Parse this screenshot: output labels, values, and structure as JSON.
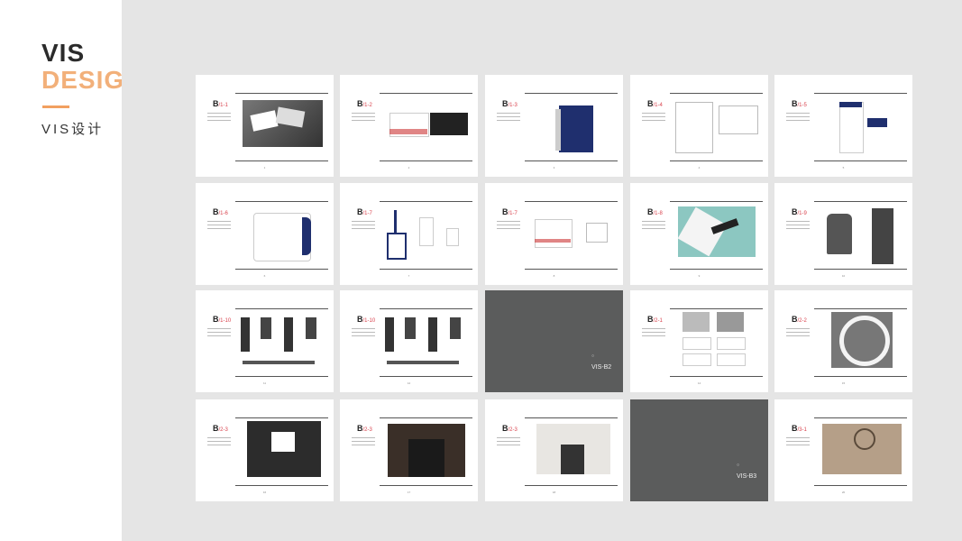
{
  "heading": {
    "line1": "VIS",
    "line2": "DESIGN",
    "subtitle": "VIS设计"
  },
  "pages": [
    {
      "num": "1",
      "code_main": "B",
      "code_sub": "/1-1",
      "kind": "cards"
    },
    {
      "num": "2",
      "code_main": "B",
      "code_sub": "/1-2",
      "kind": "bizcard"
    },
    {
      "num": "3",
      "code_main": "B",
      "code_sub": "/1-3",
      "kind": "folder"
    },
    {
      "num": "4",
      "code_main": "B",
      "code_sub": "/1-4",
      "kind": "letter"
    },
    {
      "num": "5",
      "code_main": "B",
      "code_sub": "/1-5",
      "kind": "envelope"
    },
    {
      "num": "6",
      "code_main": "B",
      "code_sub": "/1-6",
      "kind": "envelope2"
    },
    {
      "num": "7",
      "code_main": "B",
      "code_sub": "/1-7",
      "kind": "badge"
    },
    {
      "num": "8",
      "code_main": "B",
      "code_sub": "/1-7",
      "kind": "card2"
    },
    {
      "num": "9",
      "code_main": "B",
      "code_sub": "/1-8",
      "kind": "hanger"
    },
    {
      "num": "10",
      "code_main": "B",
      "code_sub": "/1-9",
      "kind": "suit"
    },
    {
      "num": "11",
      "code_main": "B",
      "code_sub": "/1-10",
      "kind": "uniform"
    },
    {
      "num": "12",
      "code_main": "B",
      "code_sub": "/1-10",
      "kind": "uniform2"
    },
    {
      "num": "13",
      "code_main": "",
      "code_sub": "",
      "kind": "dark",
      "dark_label": "VIS-B2"
    },
    {
      "num": "14",
      "code_main": "B",
      "code_sub": "/2-1",
      "kind": "signs"
    },
    {
      "num": "15",
      "code_main": "B",
      "code_sub": "/2-2",
      "kind": "round"
    },
    {
      "num": "16",
      "code_main": "B",
      "code_sub": "/2-3",
      "kind": "shop"
    },
    {
      "num": "17",
      "code_main": "B",
      "code_sub": "/2-3",
      "kind": "storefront"
    },
    {
      "num": "18",
      "code_main": "B",
      "code_sub": "/2-3",
      "kind": "building"
    },
    {
      "num": "19",
      "code_main": "",
      "code_sub": "",
      "kind": "dark",
      "dark_label": "VIS-B3"
    },
    {
      "num": "20",
      "code_main": "B",
      "code_sub": "/3-1",
      "kind": "emboss"
    }
  ]
}
